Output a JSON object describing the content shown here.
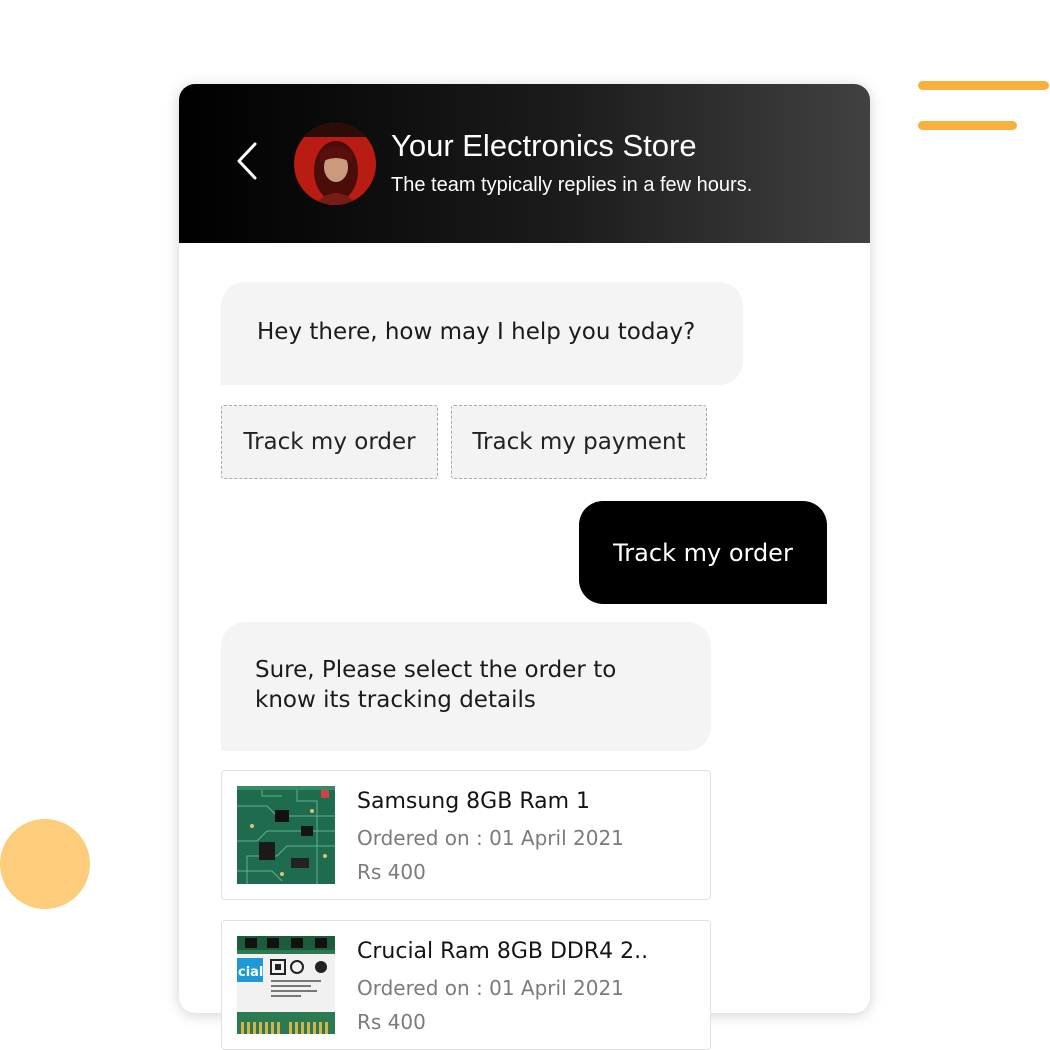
{
  "colors": {
    "accent_orange": "#f9b13e",
    "accent_orange_light": "#fdcd7c",
    "header_dark": "#000000",
    "bubble_bot_bg": "#f4f4f4",
    "bubble_user_bg": "#000000"
  },
  "header": {
    "back_icon": "chevron-left-icon",
    "store_name": "Your Electronics Store",
    "subtitle": "The team typically replies in a few hours."
  },
  "messages": [
    {
      "from": "bot",
      "text": "Hey there, how may I help you today?"
    },
    {
      "from": "user",
      "text": "Track my order"
    },
    {
      "from": "bot",
      "text": "Sure, Please select the order to know its tracking details"
    }
  ],
  "quick_replies": [
    "Track my order",
    "Track my payment"
  ],
  "orders": [
    {
      "name": "Samsung 8GB Ram 1",
      "date": "Ordered on : 01 April 2021",
      "price": "Rs 400",
      "thumbnail_icon": "ram-module-green-icon"
    },
    {
      "name": "Crucial Ram 8GB DDR4  2..",
      "date": "Ordered on : 01 April 2021",
      "price": "Rs 400",
      "thumbnail_icon": "crucial-ram-stick-icon",
      "thumbnail_label": "cial"
    }
  ]
}
